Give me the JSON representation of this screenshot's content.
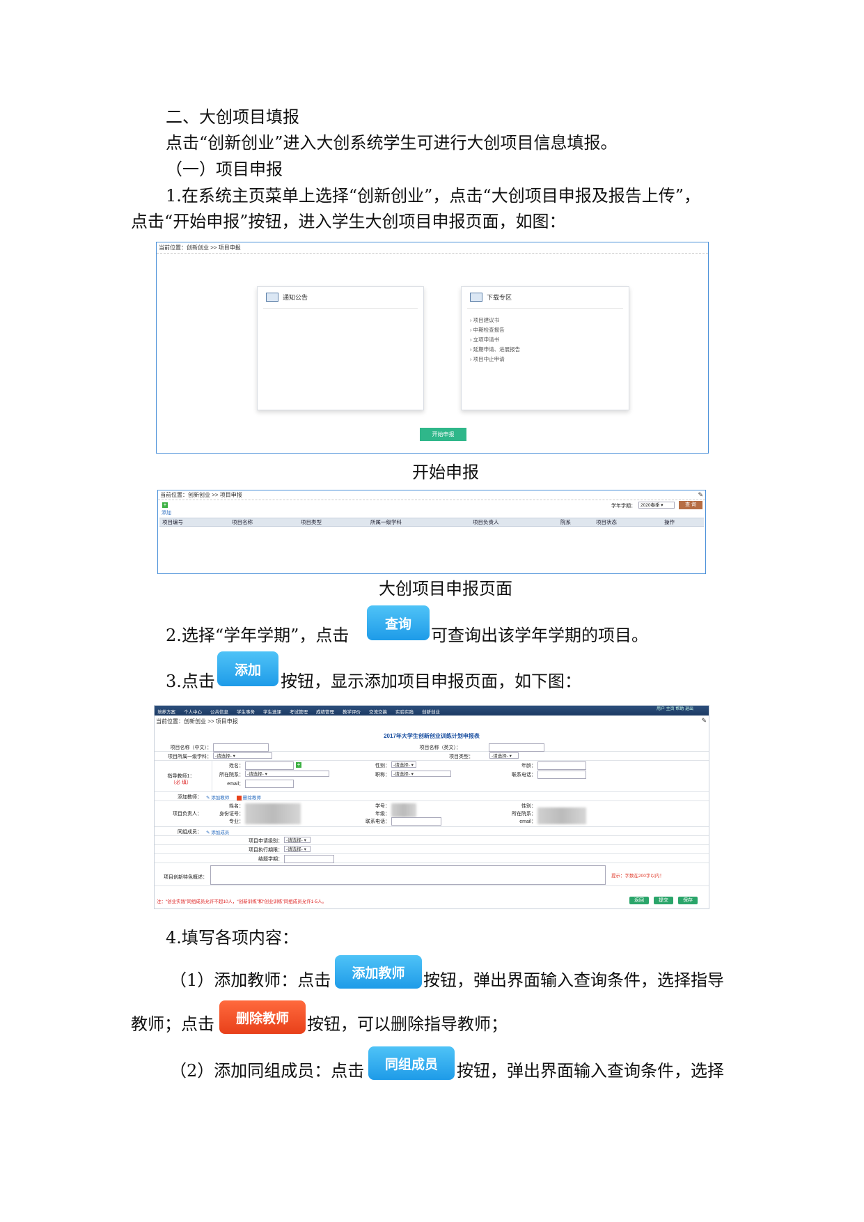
{
  "heading_section": "二、大创项目填报",
  "intro": "点击“创新创业”进入大创系统学生可进行大创项目信息填报。",
  "sub_heading": "（一）项目申报",
  "step1_line1": "1.在系统主页菜单上选择“创新创业”，点击“大创项目申报及报告上传”，",
  "step1_line2": "点击“开始申报”按钮，进入学生大创项目申报页面，如图：",
  "shot1": {
    "breadcrumb": "当前位置：创新创业 >> 项目申报",
    "notice_title": "通知公告",
    "download_title": "下载专区",
    "downloads": [
      "项目建议书",
      "中期检查报告",
      "立项申请书",
      "延期申请、进展报告",
      "项目中止申请"
    ],
    "start_button": "开始申报"
  },
  "caption1": "开始申报",
  "shot2": {
    "breadcrumb": "当前位置：创新创业 >> 项目申报",
    "add_link": "添加",
    "term_label": "学年学期：",
    "term_value": "2020春季",
    "query_button": "查 询",
    "columns": [
      "项目编号",
      "项目名称",
      "项目类型",
      "所属一级学科",
      "项目负责人",
      "院系",
      "项目状态",
      "操作"
    ]
  },
  "caption2": "大创项目申报页面",
  "step2_pre": "2.选择“学年学期”，点击",
  "step2_btn": "查询",
  "step2_post": "可查询出该学年学期的项目。",
  "step3_pre": "3.点击",
  "step3_btn": "添加",
  "step3_post": "按钮，显示添加项目申报页面，如下图：",
  "shot3": {
    "nav": [
      "培养方案",
      "个人中心",
      "公共信息",
      "学生事务",
      "学生选课",
      "考试管理",
      "成绩管理",
      "教学评价",
      "交流交换",
      "实验实践",
      "创新创业"
    ],
    "topright": "用户  主页  帮助  退出",
    "breadcrumb": "当前位置：创新创业 >> 项目申报",
    "form_title": "2017年大学生创新创业训练计划申报表",
    "name_cn": "项目名称（中文）：",
    "name_en": "项目名称（英文）：",
    "discipline": "项目所属一级学科：",
    "proj_type": "项目类型：",
    "select_default": "-请选择-",
    "teacher1": "指导教师1：",
    "required": "（必 填）",
    "t_name": "姓名：",
    "t_gender": "性别：",
    "t_age": "年龄：",
    "t_dept": "所在院系：",
    "t_title": "职称：",
    "t_phone": "联系电话：",
    "t_email": "email：",
    "add_teacher_label": "添加教师：",
    "add_teacher_link": "添加教师",
    "del_teacher_link": "删除教师",
    "leader_label": "项目负责人：",
    "l_name": "姓名：",
    "l_id": "身份证号：",
    "l_major": "专业：",
    "l_stuno": "学号：",
    "l_grade": "年级：",
    "l_phone": "联系电话：",
    "l_gender": "性别：",
    "l_dept": "所在院系：",
    "l_email": "email：",
    "member_label": "同组成员：",
    "member_link": "添加成员",
    "apply_level": "项目申请级别：",
    "exec_period": "项目执行期限：",
    "end_term": "结题学期：",
    "features_label": "项目创新特色概述：",
    "hint": "提示：字数在200字以内！",
    "note": "注：“创业实践”同组成员允许不超10人，“创新训练”和“创业训练”同组成员允许1-5人。",
    "btn_back": "返回",
    "btn_submit": "提交",
    "btn_save": "保存"
  },
  "step4": "4.填写各项内容：",
  "step4_1_pre": "（1）添加教师：点击",
  "step4_1_btn": "添加教师",
  "step4_1_post": "按钮，弹出界面输入查询条件，选择指导",
  "step4_1b_pre": "教师；点击",
  "step4_1b_btn": "删除教师",
  "step4_1b_post": "按钮，可以删除指导教师；",
  "step4_2_pre": "（2）添加同组成员：点击",
  "step4_2_btn": "同组成员",
  "step4_2_post": "按钮，弹出界面输入查询条件，选择"
}
